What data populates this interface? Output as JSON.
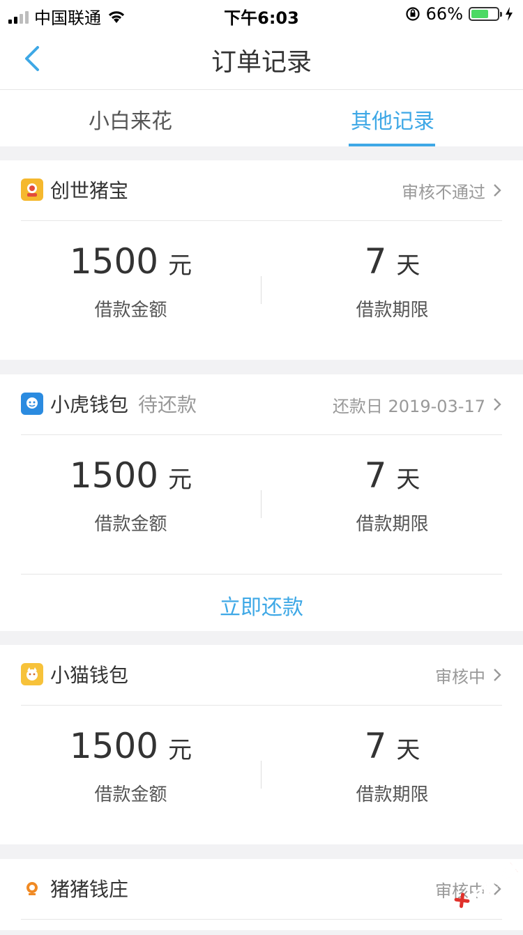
{
  "status_bar": {
    "carrier": "中国联通",
    "time": "下午6:03",
    "battery_percent_text": "66%",
    "battery_level": 0.66
  },
  "nav": {
    "title": "订单记录"
  },
  "tabs": [
    {
      "label": "小白来花",
      "active": false
    },
    {
      "label": "其他记录",
      "active": true
    }
  ],
  "colors": {
    "accent": "#3ea8e6",
    "battery_green": "#4cd964"
  },
  "orders": [
    {
      "app_name": "创世猪宝",
      "icon": "pig-treasure-icon",
      "badge": "",
      "status": "审核不通过",
      "amount": "1500",
      "amount_unit": "元",
      "amount_label": "借款金额",
      "term": "7",
      "term_unit": "天",
      "term_label": "借款期限"
    },
    {
      "app_name": "小虎钱包",
      "icon": "tiger-wallet-icon",
      "badge": "待还款",
      "status": "还款日 2019-03-17",
      "amount": "1500",
      "amount_unit": "元",
      "amount_label": "借款金额",
      "term": "7",
      "term_unit": "天",
      "term_label": "借款期限",
      "action": "立即还款"
    },
    {
      "app_name": "小猫钱包",
      "icon": "cat-wallet-icon",
      "badge": "",
      "status": "审核中",
      "amount": "1500",
      "amount_unit": "元",
      "amount_label": "借款金额",
      "term": "7",
      "term_unit": "天",
      "term_label": "借款期限"
    },
    {
      "app_name": "猪猪钱庄",
      "icon": "pig-bank-icon",
      "badge": "",
      "status": "审核中"
    }
  ],
  "watermark": {
    "text": "卡农社区"
  }
}
